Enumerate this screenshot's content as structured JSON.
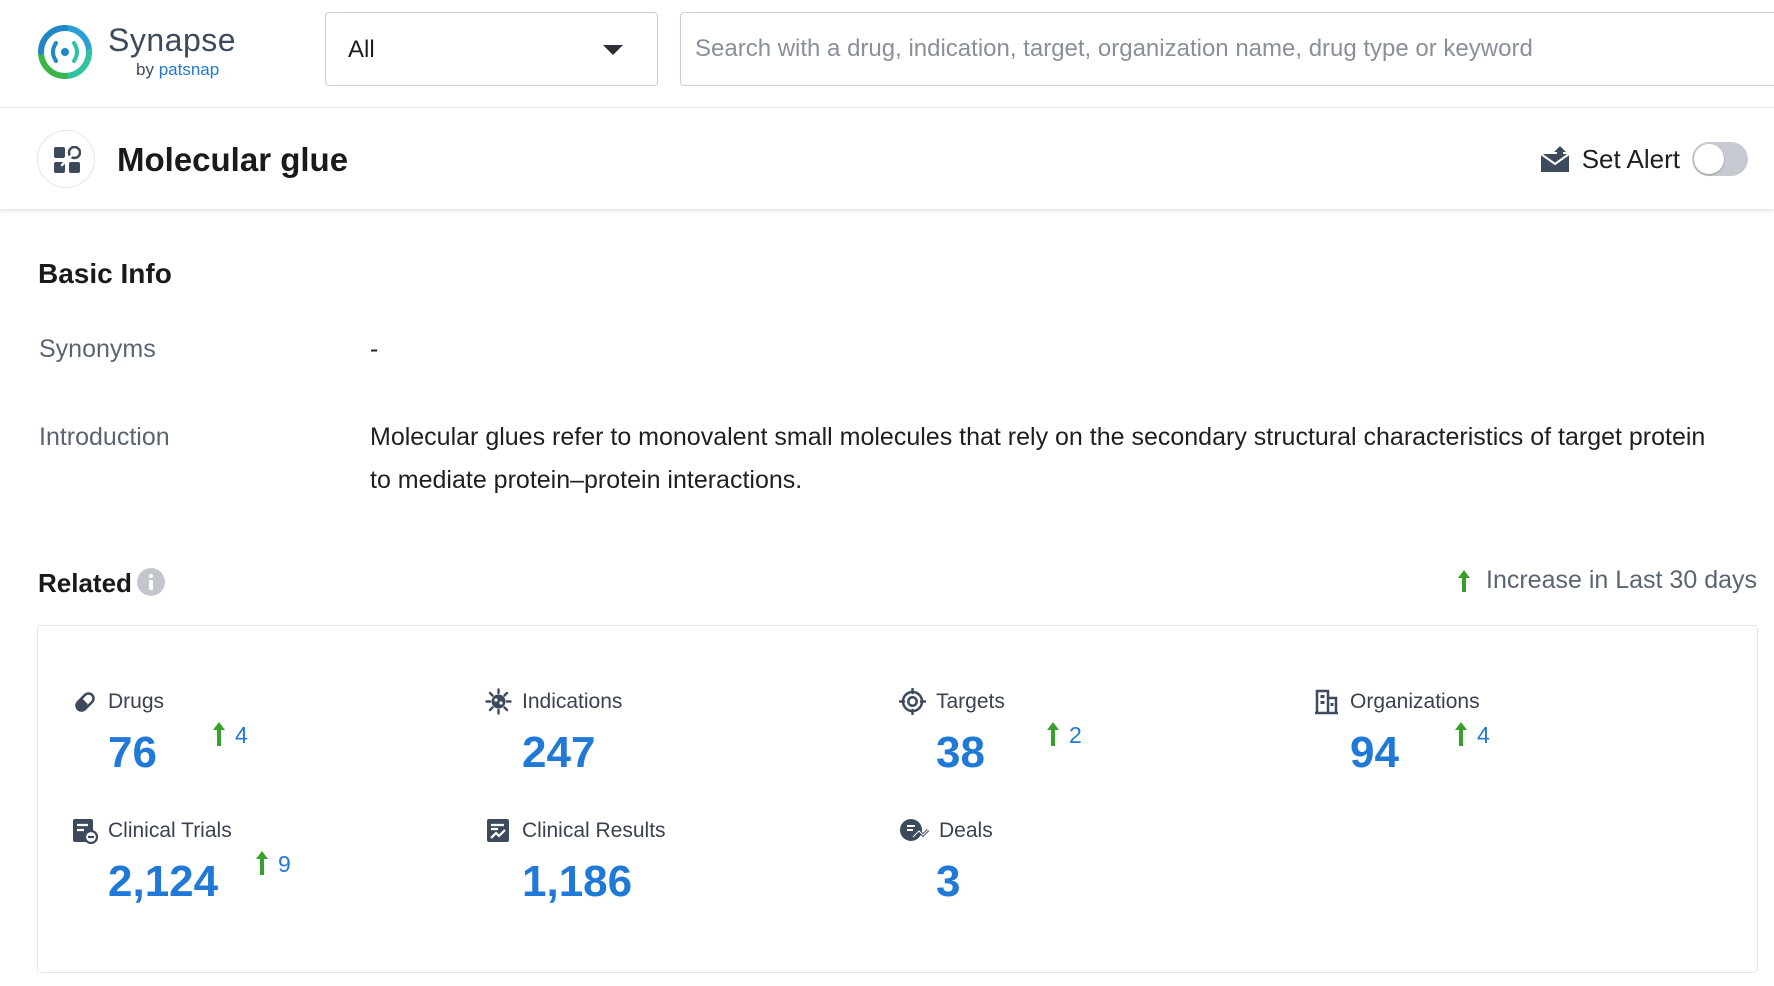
{
  "brand": {
    "name": "Synapse",
    "by": "by",
    "by_brand": "patsnap"
  },
  "filter": {
    "value": "All"
  },
  "search": {
    "placeholder": "Search with a drug, indication, target, organization name, drug type or keyword"
  },
  "page": {
    "title": "Molecular glue",
    "alert_label": "Set Alert",
    "alert_enabled": false
  },
  "basic_info": {
    "heading": "Basic Info",
    "synonyms_label": "Synonyms",
    "synonyms_value": "-",
    "introduction_label": "Introduction",
    "introduction_value": "Molecular glues refer to monovalent small molecules that rely on the secondary structural characteristics of target protein to mediate protein–protein interactions."
  },
  "related": {
    "heading": "Related",
    "legend": "Increase in Last 30 days",
    "colors": {
      "number": "#2079d6",
      "increase_arrow": "#3aa02c"
    },
    "stats": [
      {
        "label": "Drugs",
        "value": "76",
        "increase": "4",
        "icon": "pill-icon"
      },
      {
        "label": "Indications",
        "value": "247",
        "increase": "",
        "icon": "virus-icon"
      },
      {
        "label": "Targets",
        "value": "38",
        "increase": "2",
        "icon": "target-icon"
      },
      {
        "label": "Organizations",
        "value": "94",
        "increase": "4",
        "icon": "building-icon"
      },
      {
        "label": "Clinical Trials",
        "value": "2,124",
        "increase": "9",
        "icon": "clinical-trial-icon"
      },
      {
        "label": "Clinical Results",
        "value": "1,186",
        "increase": "",
        "icon": "clinical-results-icon"
      },
      {
        "label": "Deals",
        "value": "3",
        "increase": "",
        "icon": "deals-icon"
      }
    ]
  }
}
